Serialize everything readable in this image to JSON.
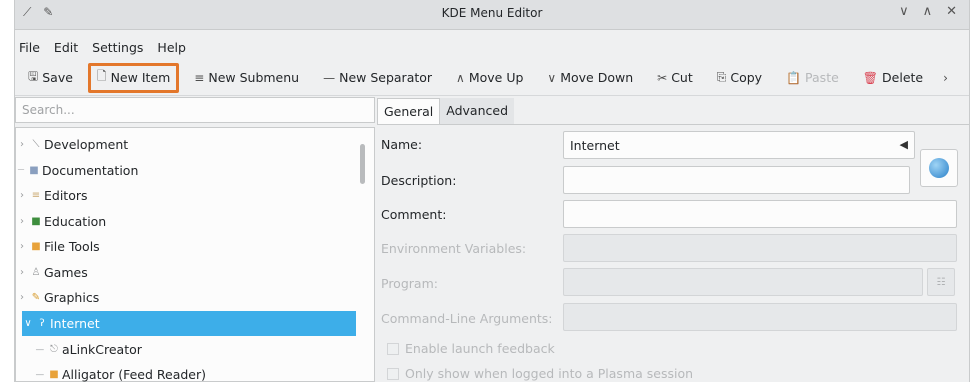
{
  "window": {
    "title": "KDE Menu Editor"
  },
  "menubar": [
    "File",
    "Edit",
    "Settings",
    "Help"
  ],
  "toolbar": {
    "save": "Save",
    "new_item": "New Item",
    "new_submenu": "New Submenu",
    "new_separator": "New Separator",
    "move_up": "Move Up",
    "move_down": "Move Down",
    "cut": "Cut",
    "copy": "Copy",
    "paste": "Paste",
    "delete": "Delete"
  },
  "search": {
    "placeholder": "Search..."
  },
  "tree": [
    {
      "label": "Development",
      "icon": "development-icon"
    },
    {
      "label": "Documentation",
      "icon": "documentation-icon"
    },
    {
      "label": "Editors",
      "icon": "editors-icon"
    },
    {
      "label": "Education",
      "icon": "education-icon"
    },
    {
      "label": "File Tools",
      "icon": "file-tools-icon"
    },
    {
      "label": "Games",
      "icon": "games-icon"
    },
    {
      "label": "Graphics",
      "icon": "graphics-icon"
    },
    {
      "label": "Internet",
      "icon": "internet-icon",
      "selected": true
    },
    {
      "label": "aLinkCreator",
      "icon": "alinkcreator-icon"
    },
    {
      "label": "Alligator (Feed Reader)",
      "icon": "alligator-icon"
    }
  ],
  "tabs": {
    "general": "General",
    "advanced": "Advanced"
  },
  "form": {
    "name_label": "Name:",
    "name_value": "Internet",
    "description_label": "Description:",
    "comment_label": "Comment:",
    "env_label": "Environment Variables:",
    "program_label": "Program:",
    "cmdline_label": "Command-Line Arguments:",
    "launch_feedback": "Enable launch feedback",
    "plasma_only": "Only show when logged into a Plasma session"
  },
  "colors": {
    "accent": "#3daee9",
    "highlight": "#e3772b",
    "delete": "#da4453"
  }
}
